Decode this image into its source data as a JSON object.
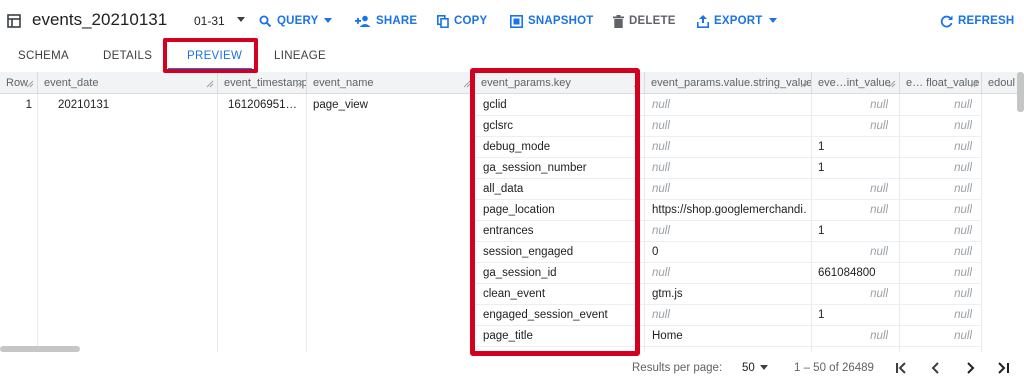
{
  "toolbar": {
    "title": "events_20210131",
    "date_suffix": "01-31",
    "query_label": "QUERY",
    "share_label": "SHARE",
    "copy_label": "COPY",
    "snapshot_label": "SNAPSHOT",
    "delete_label": "DELETE",
    "export_label": "EXPORT",
    "refresh_label": "REFRESH"
  },
  "tabs": [
    "SCHEMA",
    "DETAILS",
    "PREVIEW",
    "LINEAGE"
  ],
  "active_tab": "PREVIEW",
  "columns": [
    "Row",
    "event_date",
    "event_timestamp",
    "event_name",
    "event_params.key",
    "event_params.value.string_value",
    "eve…int_value",
    "e… float_value",
    "edoul"
  ],
  "row": {
    "number": "1",
    "event_date": "20210131",
    "event_timestamp": "161206951…",
    "event_name": "page_view"
  },
  "params": [
    {
      "key": "gclid",
      "string_value": "null",
      "int_value": "null",
      "float_value": "null"
    },
    {
      "key": "gclsrc",
      "string_value": "null",
      "int_value": "null",
      "float_value": "null"
    },
    {
      "key": "debug_mode",
      "string_value": "null",
      "int_value": "1",
      "float_value": "null"
    },
    {
      "key": "ga_session_number",
      "string_value": "null",
      "int_value": "1",
      "float_value": "null"
    },
    {
      "key": "all_data",
      "string_value": "null",
      "int_value": "null",
      "float_value": "null"
    },
    {
      "key": "page_location",
      "string_value": "https://shop.googlemerchandi…",
      "int_value": "null",
      "float_value": "null"
    },
    {
      "key": "entrances",
      "string_value": "null",
      "int_value": "1",
      "float_value": "null"
    },
    {
      "key": "session_engaged",
      "string_value": "0",
      "int_value": "null",
      "float_value": "null"
    },
    {
      "key": "ga_session_id",
      "string_value": "null",
      "int_value": "661084800",
      "float_value": "null"
    },
    {
      "key": "clean_event",
      "string_value": "gtm.js",
      "int_value": "null",
      "float_value": "null"
    },
    {
      "key": "engaged_session_event",
      "string_value": "null",
      "int_value": "1",
      "float_value": "null"
    },
    {
      "key": "page_title",
      "string_value": "Home",
      "int_value": "null",
      "float_value": "null"
    }
  ],
  "pagination": {
    "results_label": "Results per page:",
    "page_size": "50",
    "range": "1 – 50 of 26489"
  },
  "colors": {
    "accent": "#1a73e8",
    "highlight": "#d3001f"
  }
}
